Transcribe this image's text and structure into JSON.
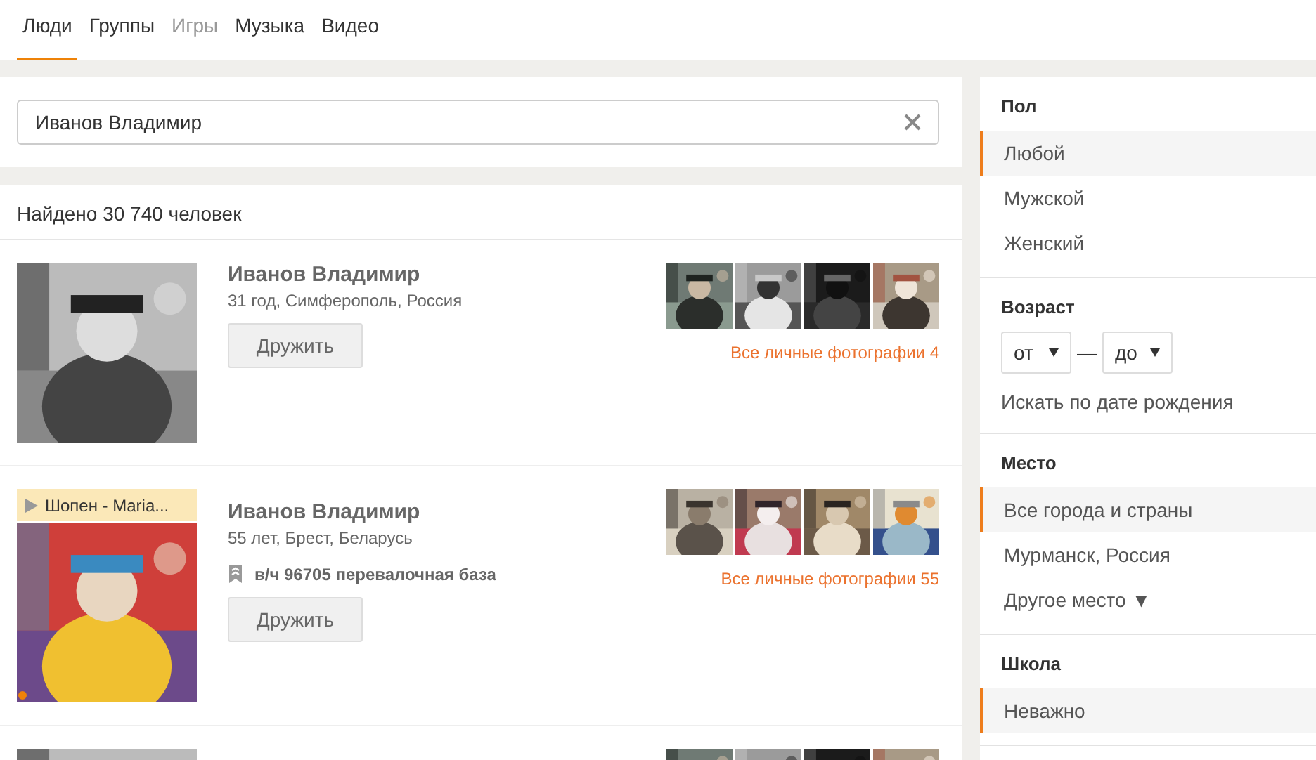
{
  "tabs": [
    {
      "label": "Люди",
      "selected": true,
      "disabled": false
    },
    {
      "label": "Группы",
      "selected": false,
      "disabled": false
    },
    {
      "label": "Игры",
      "selected": false,
      "disabled": true
    },
    {
      "label": "Музыка",
      "selected": false,
      "disabled": false
    },
    {
      "label": "Видео",
      "selected": false,
      "disabled": false
    }
  ],
  "search": {
    "value": "Иванов Владимир"
  },
  "results_count": "Найдено 30 740 человек",
  "results": [
    {
      "name": "Иванов Владимир",
      "details": "31 год, Симферополь, Россия",
      "button": "Дружить",
      "photos_link": "Все личные фотографии 4",
      "online": false
    },
    {
      "name": "Иванов Владимир",
      "details": "55 лет, Брест, Беларусь",
      "job": "в/ч 96705 перевалочная база",
      "status": "Шопен - Maria...",
      "button": "Дружить",
      "photos_link": "Все личные фотографии 55",
      "online": true
    },
    {
      "online": false
    }
  ],
  "filters": [
    {
      "title": "Пол",
      "kind": "options",
      "options": [
        {
          "label": "Любой",
          "selected": true
        },
        {
          "label": "Мужской",
          "selected": false
        },
        {
          "label": "Женский",
          "selected": false
        }
      ]
    },
    {
      "title": "Возраст",
      "kind": "range",
      "from": "от",
      "separator": "—",
      "to": "до",
      "link": "Искать по дате рождения"
    },
    {
      "title": "Место",
      "kind": "options",
      "options": [
        {
          "label": "Все города и страны",
          "selected": true
        },
        {
          "label": "Мурманск, Россия",
          "selected": false
        },
        {
          "label": "Другое место ▼",
          "selected": false
        }
      ]
    },
    {
      "title": "Школа",
      "kind": "options",
      "options": [
        {
          "label": "Неважно",
          "selected": true
        }
      ]
    }
  ]
}
